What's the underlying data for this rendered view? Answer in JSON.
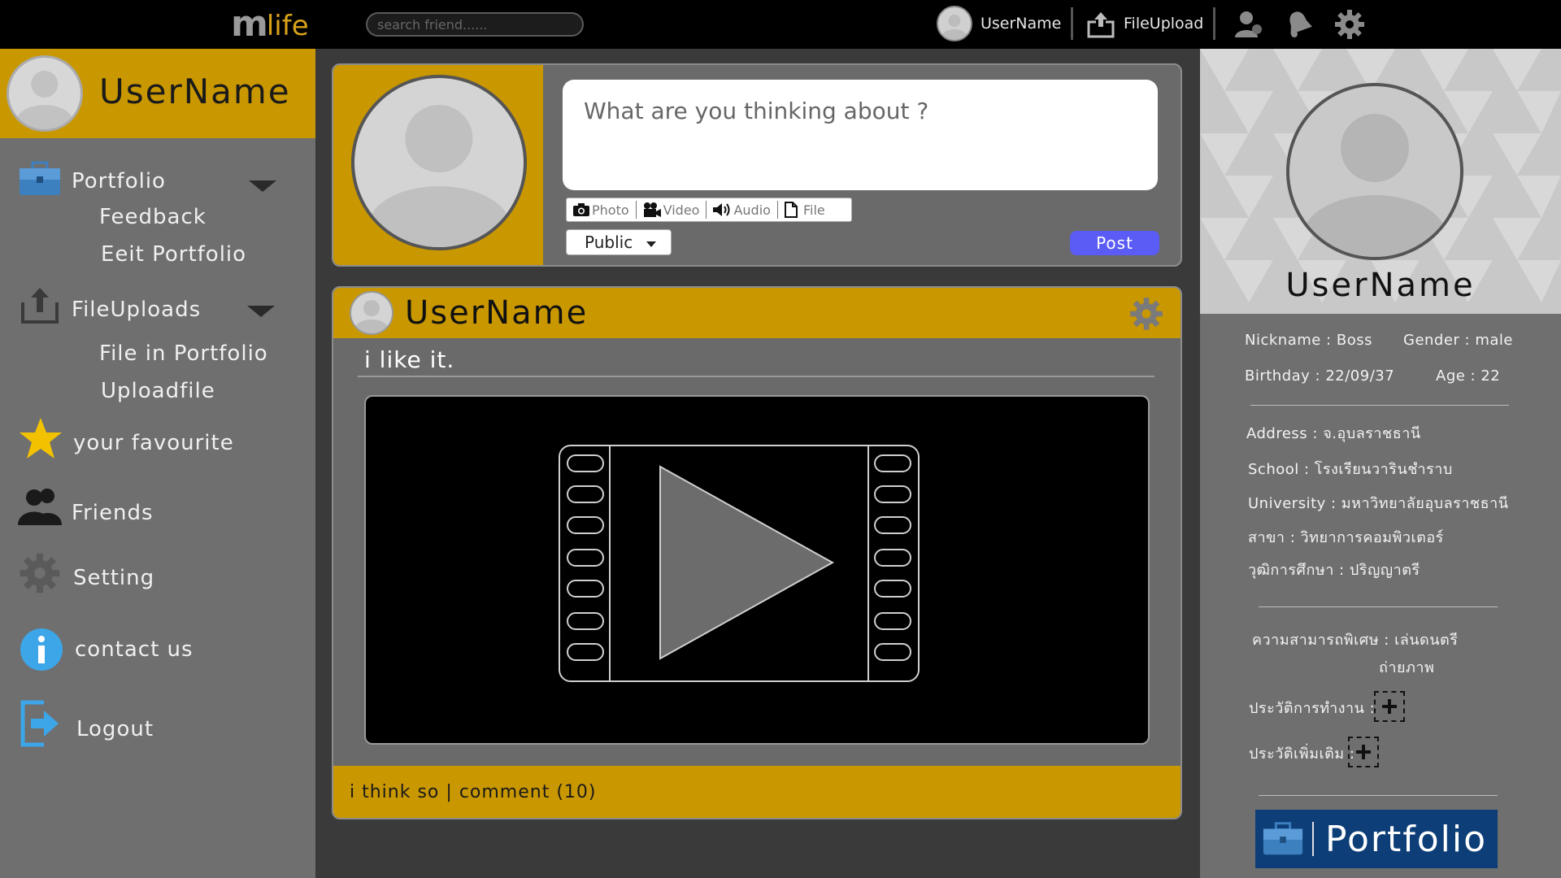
{
  "app": {
    "logo_m": "m",
    "logo_rest": "life",
    "search_placeholder": "search friend......",
    "top_username": "UserName",
    "top_upload": "FileUpload"
  },
  "icons": {
    "search": "search-icon",
    "upload": "upload-icon",
    "friends": "friend-requests-icon",
    "notifications": "notifications-icon",
    "settings": "gear-icon"
  },
  "sidebar": {
    "username": "UserName",
    "items": [
      {
        "label": "Portfolio",
        "icon": "briefcase-icon",
        "expandable": true
      },
      {
        "label": "Feedback",
        "sub": true
      },
      {
        "label": "Eeit Portfolio",
        "sub": true
      },
      {
        "label": "FileUploads",
        "icon": "upload-icon",
        "expandable": true
      },
      {
        "label": "File in Portfolio",
        "sub": true
      },
      {
        "label": "Uploadfile",
        "sub": true
      },
      {
        "label": "your favourite",
        "icon": "star-icon"
      },
      {
        "label": "Friends",
        "icon": "friends-icon"
      },
      {
        "label": "Setting",
        "icon": "gear-icon"
      },
      {
        "label": "contact us",
        "icon": "info-icon"
      },
      {
        "label": "Logout",
        "icon": "logout-icon"
      }
    ]
  },
  "composer": {
    "placeholder": "What are you thinking about ?",
    "attach": [
      "Photo",
      "Video",
      "Audio",
      "File"
    ],
    "privacy": "Public",
    "post_label": "Post"
  },
  "post": {
    "username": "UserName",
    "text": "i like it.",
    "footer_like": "i think so",
    "footer_sep": "|",
    "footer_comment": "comment (10)"
  },
  "profile": {
    "username": "UserName",
    "nickname": "Nickname : Boss",
    "gender": "Gender : male",
    "birthday": "Birthday : 22/09/37",
    "age": "Age : 22",
    "address": "Address : จ.อุบลราชธานี",
    "school": "School : โรงเรียนวารินชำราบ",
    "university": "University : มหาวิทยาลัยอุบลราชธานี",
    "major": "สาขา : วิทยาการคอมพิวเตอร์",
    "degree": "วุฒิการศึกษา : ปริญญาตรี",
    "skills_label": "ความสามารถพิเศษ : เล่นดนตรี",
    "skills_more": "ถ่ายภาพ",
    "work_history": "ประวัติการทำงาน :",
    "more_history": "ประวัติเพิ่มเติม :",
    "portfolio_button": "Portfolio"
  },
  "colors": {
    "gold": "#c99700",
    "sidebar": "#6f6f6f",
    "post_button": "#5b5bf5",
    "portfolio_button": "#0d3e78"
  }
}
